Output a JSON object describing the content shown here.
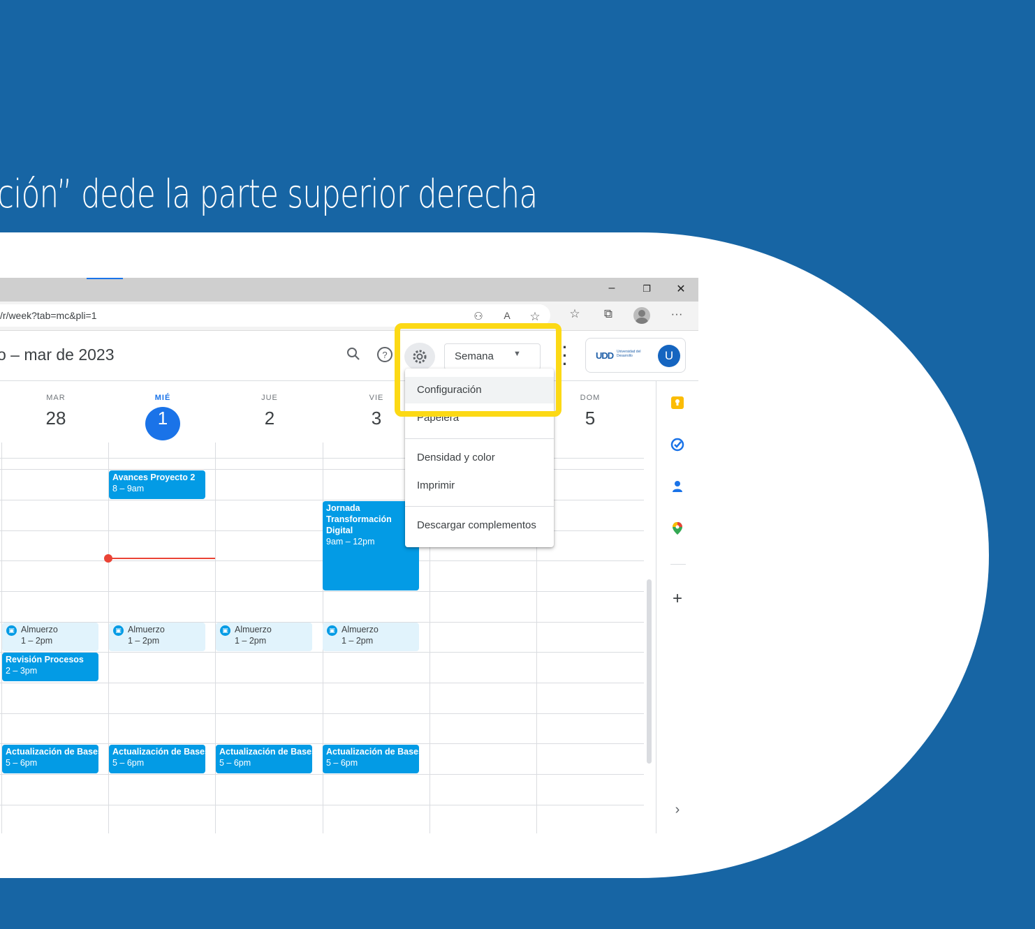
{
  "slide": {
    "caption": "ción” dede la parte superior derecha"
  },
  "browser": {
    "url": "/r/week?tab=mc&pli=1",
    "window_controls": {
      "minimize": "–",
      "restore": "❐",
      "close": "✕"
    },
    "more_label": "···"
  },
  "calendar": {
    "date_range": "o – mar de 2023",
    "view_select": "Semana",
    "avatar_letter": "U",
    "org_logo": {
      "mark": "UDD",
      "text": "Universidad del Desarrollo"
    },
    "days": [
      {
        "name": "MAR",
        "num": "28"
      },
      {
        "name": "MIÉ",
        "num": "1",
        "today": true
      },
      {
        "name": "JUE",
        "num": "2"
      },
      {
        "name": "VIE",
        "num": "3"
      },
      {
        "name": "DOM",
        "num": "5"
      }
    ],
    "events": {
      "avances": {
        "title": "Avances Proyecto 2",
        "time": "8 – 9am"
      },
      "jornada": {
        "title": "Jornada Transformación Digital",
        "time": "9am – 12pm"
      },
      "almuerzo": {
        "title": "Almuerzo",
        "time": "1 – 2pm"
      },
      "revision": {
        "title": "Revisión Procesos",
        "time": "2 – 3pm"
      },
      "actualizacion": {
        "title": "Actualización de Bases",
        "time": "5 – 6pm"
      }
    }
  },
  "settings_menu": {
    "items": [
      "Configuración",
      "Papelera",
      "Densidad y color",
      "Imprimir",
      "Descargar complementos"
    ]
  },
  "side_panel": {
    "add_label": "+",
    "expand_label": "›"
  },
  "colors": {
    "background": "#1765a4",
    "highlight": "#fcd915",
    "event": "#039be5",
    "today": "#1a73e8"
  }
}
